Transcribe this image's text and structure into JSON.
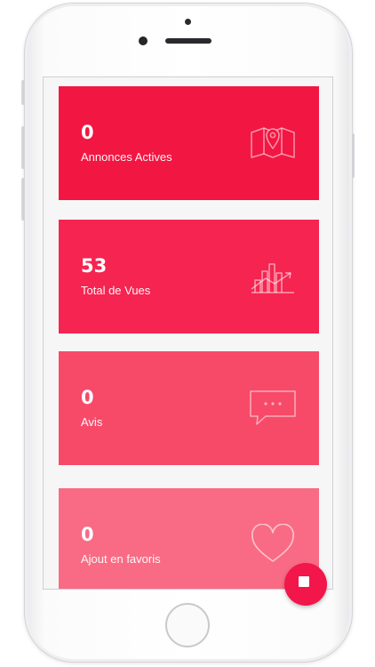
{
  "colors": {
    "card1": "#f21642",
    "card2": "#f52450",
    "card3": "#f74a69",
    "card4": "#f96b84",
    "fab": "#f2164a"
  },
  "stats": [
    {
      "count": "0",
      "label": "Annonces Actives",
      "icon": "map-icon"
    },
    {
      "count": "53",
      "label": "Total de Vues",
      "icon": "chart-growth-icon"
    },
    {
      "count": "0",
      "label": "Avis",
      "icon": "chat-bubble-icon"
    },
    {
      "count": "0",
      "label": "Ajout en favoris",
      "icon": "heart-icon"
    }
  ],
  "fab": {
    "icon": "square-icon"
  }
}
